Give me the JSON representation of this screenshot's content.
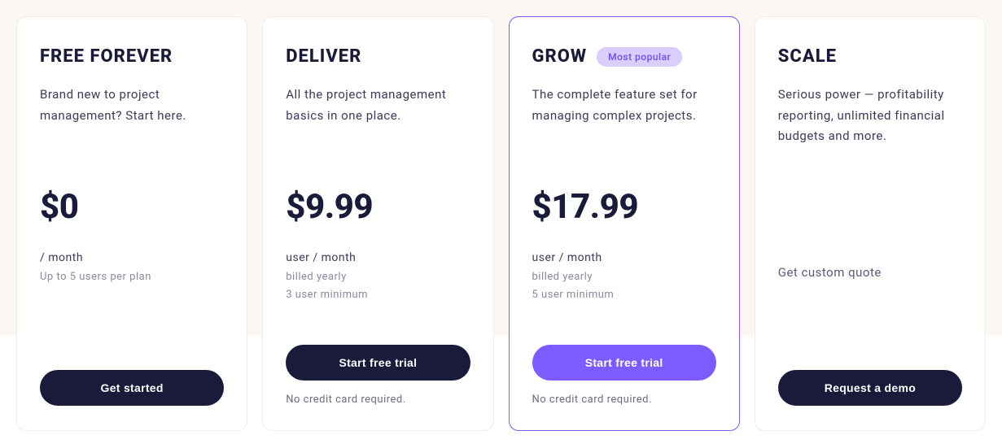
{
  "plans": [
    {
      "title": "FREE FOREVER",
      "badge": null,
      "description": "Brand new to project management? Start here.",
      "price": "$0",
      "unit": "/ month",
      "billed": null,
      "minimum": "Up to 5 users per plan",
      "custom_quote": null,
      "cta": "Get started",
      "footnote": null
    },
    {
      "title": "DELIVER",
      "badge": null,
      "description": "All the project management basics in one place.",
      "price": "$9.99",
      "unit": "user / month",
      "billed": "billed yearly",
      "minimum": "3 user minimum",
      "custom_quote": null,
      "cta": "Start free trial",
      "footnote": "No credit card required."
    },
    {
      "title": "GROW",
      "badge": "Most popular",
      "description": "The complete feature set for managing complex projects.",
      "price": "$17.99",
      "unit": "user / month",
      "billed": "billed yearly",
      "minimum": "5 user minimum",
      "custom_quote": null,
      "cta": "Start free trial",
      "footnote": "No credit card required."
    },
    {
      "title": "SCALE",
      "badge": null,
      "description": "Serious power — profitability reporting, unlimited financial budgets and more.",
      "price": null,
      "unit": null,
      "billed": null,
      "minimum": null,
      "custom_quote": "Get custom quote",
      "cta": "Request a demo",
      "footnote": null
    }
  ]
}
